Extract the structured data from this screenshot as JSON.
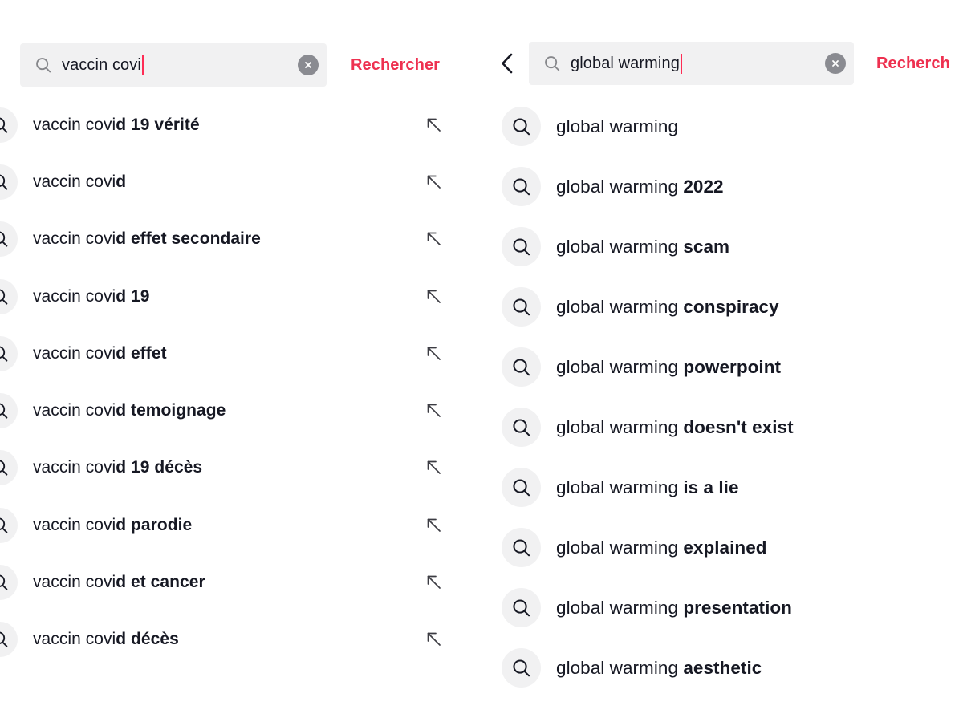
{
  "colors": {
    "accent": "#ee3150",
    "caret": "#fe2c55",
    "field_bg": "#f1f1f2",
    "icon_bg": "#f1f1f2",
    "text": "#161823",
    "clear_btn_bg": "#8a8b91",
    "page_bg": "#ffffff"
  },
  "left_panel": {
    "search": {
      "value": "vaccin covi",
      "placeholder": "Rechercher",
      "submit_label": "Rechercher",
      "search_icon": "search-icon",
      "clear_icon": "clear-circle-icon"
    },
    "suggestions": [
      {
        "prefix": "vaccin covi",
        "match": "d 19 vérité",
        "full": "vaccin covid 19 vérité"
      },
      {
        "prefix": "vaccin covi",
        "match": "d",
        "full": "vaccin covid"
      },
      {
        "prefix": "vaccin covi",
        "match": "d effet secondaire",
        "full": "vaccin covid effet secondaire"
      },
      {
        "prefix": "vaccin covi",
        "match": "d 19",
        "full": "vaccin covid 19"
      },
      {
        "prefix": "vaccin covi",
        "match": "d effet",
        "full": "vaccin covid effet"
      },
      {
        "prefix": "vaccin covi",
        "match": "d temoignage",
        "full": "vaccin covid temoignage"
      },
      {
        "prefix": "vaccin covi",
        "match": "d 19 décès",
        "full": "vaccin covid 19 décès"
      },
      {
        "prefix": "vaccin covi",
        "match": "d parodie",
        "full": "vaccin covid parodie"
      },
      {
        "prefix": "vaccin covi",
        "match": "d et cancer",
        "full": "vaccin covid et cancer"
      },
      {
        "prefix": "vaccin covi",
        "match": "d décès",
        "full": "vaccin covid décès"
      }
    ],
    "row_icon": "search-icon",
    "row_action_icon": "arrow-up-left-icon"
  },
  "right_panel": {
    "back_icon": "chevron-left-icon",
    "search": {
      "value": "global warming",
      "placeholder": "Rechercher",
      "submit_label": "Recherch",
      "search_icon": "search-icon",
      "clear_icon": "clear-circle-icon"
    },
    "suggestions": [
      {
        "prefix": "global warming",
        "match": "",
        "full": "global warming"
      },
      {
        "prefix": "global warming",
        "match": " 2022",
        "full": "global warming 2022"
      },
      {
        "prefix": "global warming",
        "match": " scam",
        "full": "global warming scam"
      },
      {
        "prefix": "global warming",
        "match": " conspiracy",
        "full": "global warming conspiracy"
      },
      {
        "prefix": "global warming",
        "match": " powerpoint",
        "full": "global warming powerpoint"
      },
      {
        "prefix": "global warming",
        "match": " doesn't exist",
        "full": "global warming doesn't exist"
      },
      {
        "prefix": "global warming",
        "match": " is a lie",
        "full": "global warming is a lie"
      },
      {
        "prefix": "global warming",
        "match": " explained",
        "full": "global warming explained"
      },
      {
        "prefix": "global warming",
        "match": " presentation",
        "full": "global warming presentation"
      },
      {
        "prefix": "global warming",
        "match": " aesthetic",
        "full": "global warming aesthetic"
      }
    ],
    "row_icon": "search-icon"
  }
}
